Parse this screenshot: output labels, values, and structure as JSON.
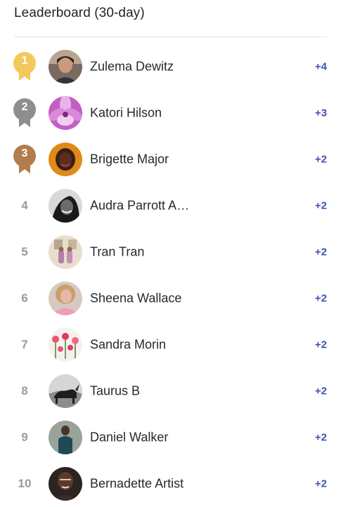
{
  "header": {
    "title": "Leaderboard (30-day)"
  },
  "colors": {
    "gold": "#f3c85d",
    "silver": "#8e8e8e",
    "bronze": "#b27d4c",
    "score": "#3f51b5",
    "rank_gray": "#9a9a9a"
  },
  "leaders": [
    {
      "rank": "1",
      "name": "Zulema Dewitz",
      "score": "+4",
      "medal": "gold"
    },
    {
      "rank": "2",
      "name": "Katori Hilson",
      "score": "+3",
      "medal": "silver"
    },
    {
      "rank": "3",
      "name": "Brigette Major",
      "score": "+2",
      "medal": "bronze"
    },
    {
      "rank": "4",
      "name": "Audra Parrott A…",
      "score": "+2"
    },
    {
      "rank": "5",
      "name": "Tran Tran",
      "score": "+2"
    },
    {
      "rank": "6",
      "name": "Sheena Wallace",
      "score": "+2"
    },
    {
      "rank": "7",
      "name": "Sandra Morin",
      "score": "+2"
    },
    {
      "rank": "8",
      "name": "Taurus B",
      "score": "+2"
    },
    {
      "rank": "9",
      "name": "Daniel Walker",
      "score": "+2"
    },
    {
      "rank": "10",
      "name": "Bernadette Artist",
      "score": "+2"
    }
  ]
}
